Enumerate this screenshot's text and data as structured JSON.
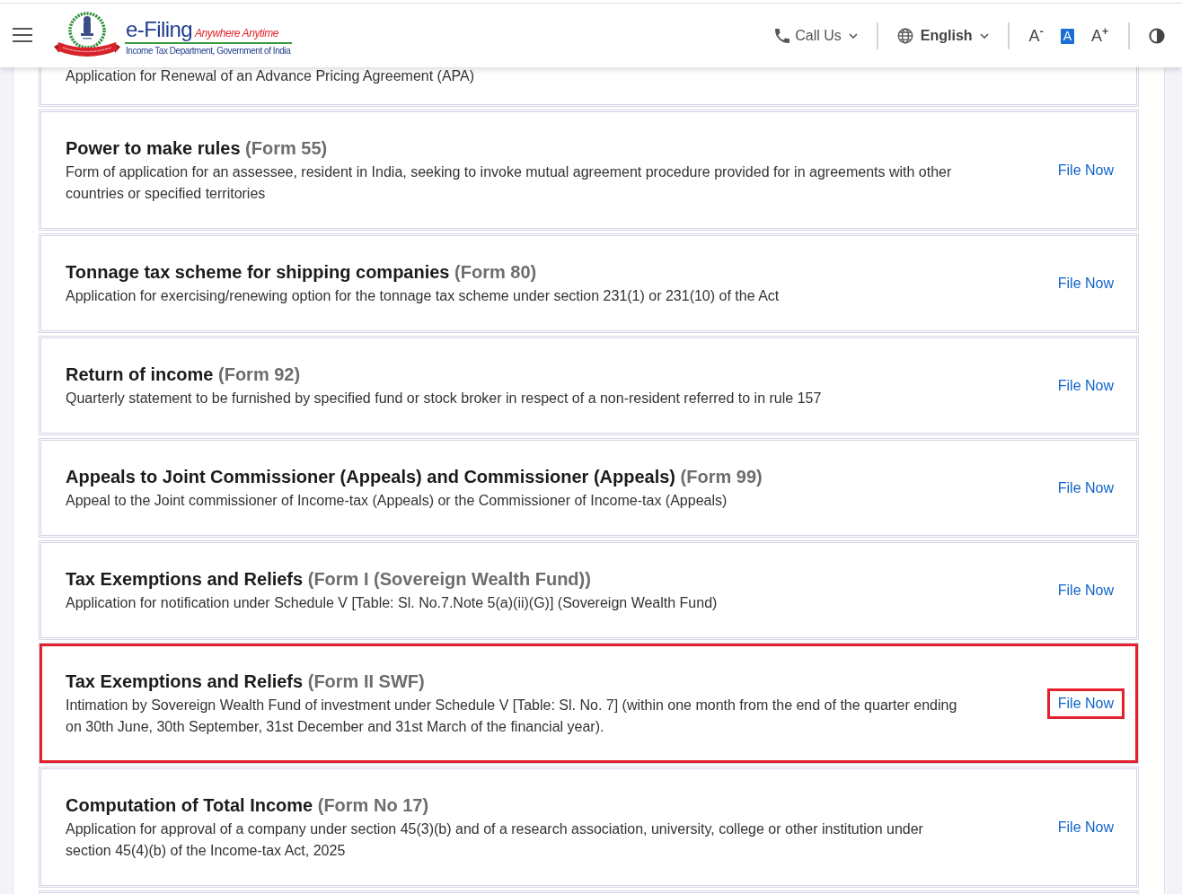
{
  "header": {
    "logo": {
      "title": "e-Filing",
      "tagline": "Anywhere Anytime",
      "subtitle": "Income Tax Department, Government of India"
    },
    "call_us": {
      "label": "Call Us"
    },
    "language": {
      "label": "English"
    },
    "font_size_buttons": [
      {
        "label": "A$^{-}$",
        "selected": false
      },
      {
        "label": "A",
        "selected": true
      },
      {
        "label": "A$^{+}$",
        "selected": false
      }
    ]
  },
  "forms": [
    {
      "description": "Application for Renewal of an Advance Pricing Agreement (APA)",
      "highlighted": false
    },
    {
      "title": "Power to make rules",
      "form_number": "(Form 55)",
      "description": "Form of application for an assessee, resident in India, seeking to invoke mutual agreement procedure provided for in agreements with other countries or specified territories",
      "link": "File Now",
      "highlighted": false
    },
    {
      "title": "Tonnage tax scheme for shipping companies",
      "form_number": "(Form 80)",
      "description": "Application for exercising/renewing option for the tonnage tax scheme under section 231(1) or 231(10) of the Act",
      "link": "File Now",
      "highlighted": false
    },
    {
      "title": "Return of income",
      "form_number": "(Form 92)",
      "description": "Quarterly statement to be furnished by specified fund or stock broker in respect of a non-resident referred to in rule 157",
      "link": "File Now",
      "highlighted": false
    },
    {
      "title": "Appeals to Joint Commissioner (Appeals) and Commissioner (Appeals)",
      "form_number": "(Form 99)",
      "description": "Appeal to the Joint commissioner of Income-tax (Appeals) or the Commissioner of Income-tax (Appeals)",
      "link": "File Now",
      "highlighted": false
    },
    {
      "title": "Tax Exemptions and Reliefs",
      "form_number": "(Form I (Sovereign Wealth Fund))",
      "description": "Application for notification under Schedule V [Table: Sl. No.7.Note 5(a)(ii)(G)] (Sovereign Wealth Fund)",
      "link": "File Now",
      "highlighted": false
    },
    {
      "title": "Tax Exemptions and Reliefs",
      "form_number": "(Form II SWF)",
      "description": "Intimation by Sovereign Wealth Fund of investment under Schedule V [Table: Sl. No. 7] (within one month from the end of the quarter ending on 30th June, 30th September, 31st December and 31st March of the financial year).",
      "link": "File Now",
      "highlighted": true
    },
    {
      "title": "Computation of Total Income",
      "form_number": "(Form No 17)",
      "description": "Application for approval of a company under section 45(3)(b) and of a research association, university, college or other institution under section 45(4)(b) of the Income-tax Act, 2025",
      "link": "File Now",
      "highlighted": false
    }
  ]
}
